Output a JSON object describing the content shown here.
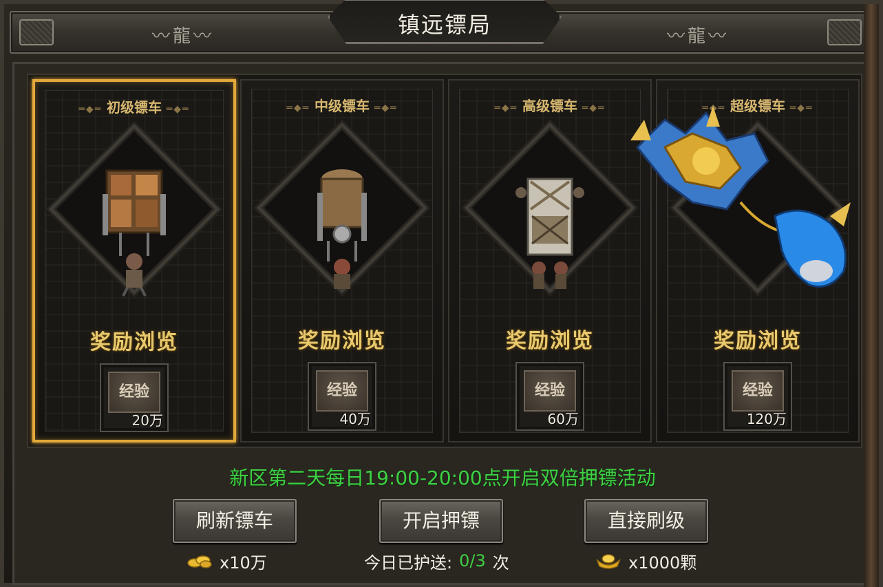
{
  "window": {
    "title": "镇远镖局"
  },
  "title_bar": {
    "dragon_left": "〰龍〰",
    "dragon_right": "〰龍〰"
  },
  "cards": [
    {
      "name": "初级镖车",
      "reward_title": "奖励浏览",
      "reward_item": "经验",
      "reward_amount": "20万",
      "selected": true
    },
    {
      "name": "中级镖车",
      "reward_title": "奖励浏览",
      "reward_item": "经验",
      "reward_amount": "40万",
      "selected": false
    },
    {
      "name": "高级镖车",
      "reward_title": "奖励浏览",
      "reward_item": "经验",
      "reward_amount": "60万",
      "selected": false
    },
    {
      "name": "超级镖车",
      "reward_title": "奖励浏览",
      "reward_item": "经验",
      "reward_amount": "120万",
      "selected": false
    }
  ],
  "notice": "新区第二天每日19:00-20:00点开启双倍押镖活动",
  "buttons": {
    "refresh": {
      "label": "刷新镖车",
      "cost": "x10万",
      "cost_icon": "gold-coins-icon"
    },
    "start": {
      "label": "开启押镖"
    },
    "direct": {
      "label": "直接刷级",
      "cost": "x1000颗",
      "cost_icon": "gold-ingot-icon"
    }
  },
  "escort": {
    "prefix": "今日已护送:",
    "count": "0/3",
    "suffix": "次"
  },
  "colors": {
    "accent_gold": "#e2a83a",
    "notice_green": "#3fd044",
    "reward_text": "#e8c96e"
  }
}
